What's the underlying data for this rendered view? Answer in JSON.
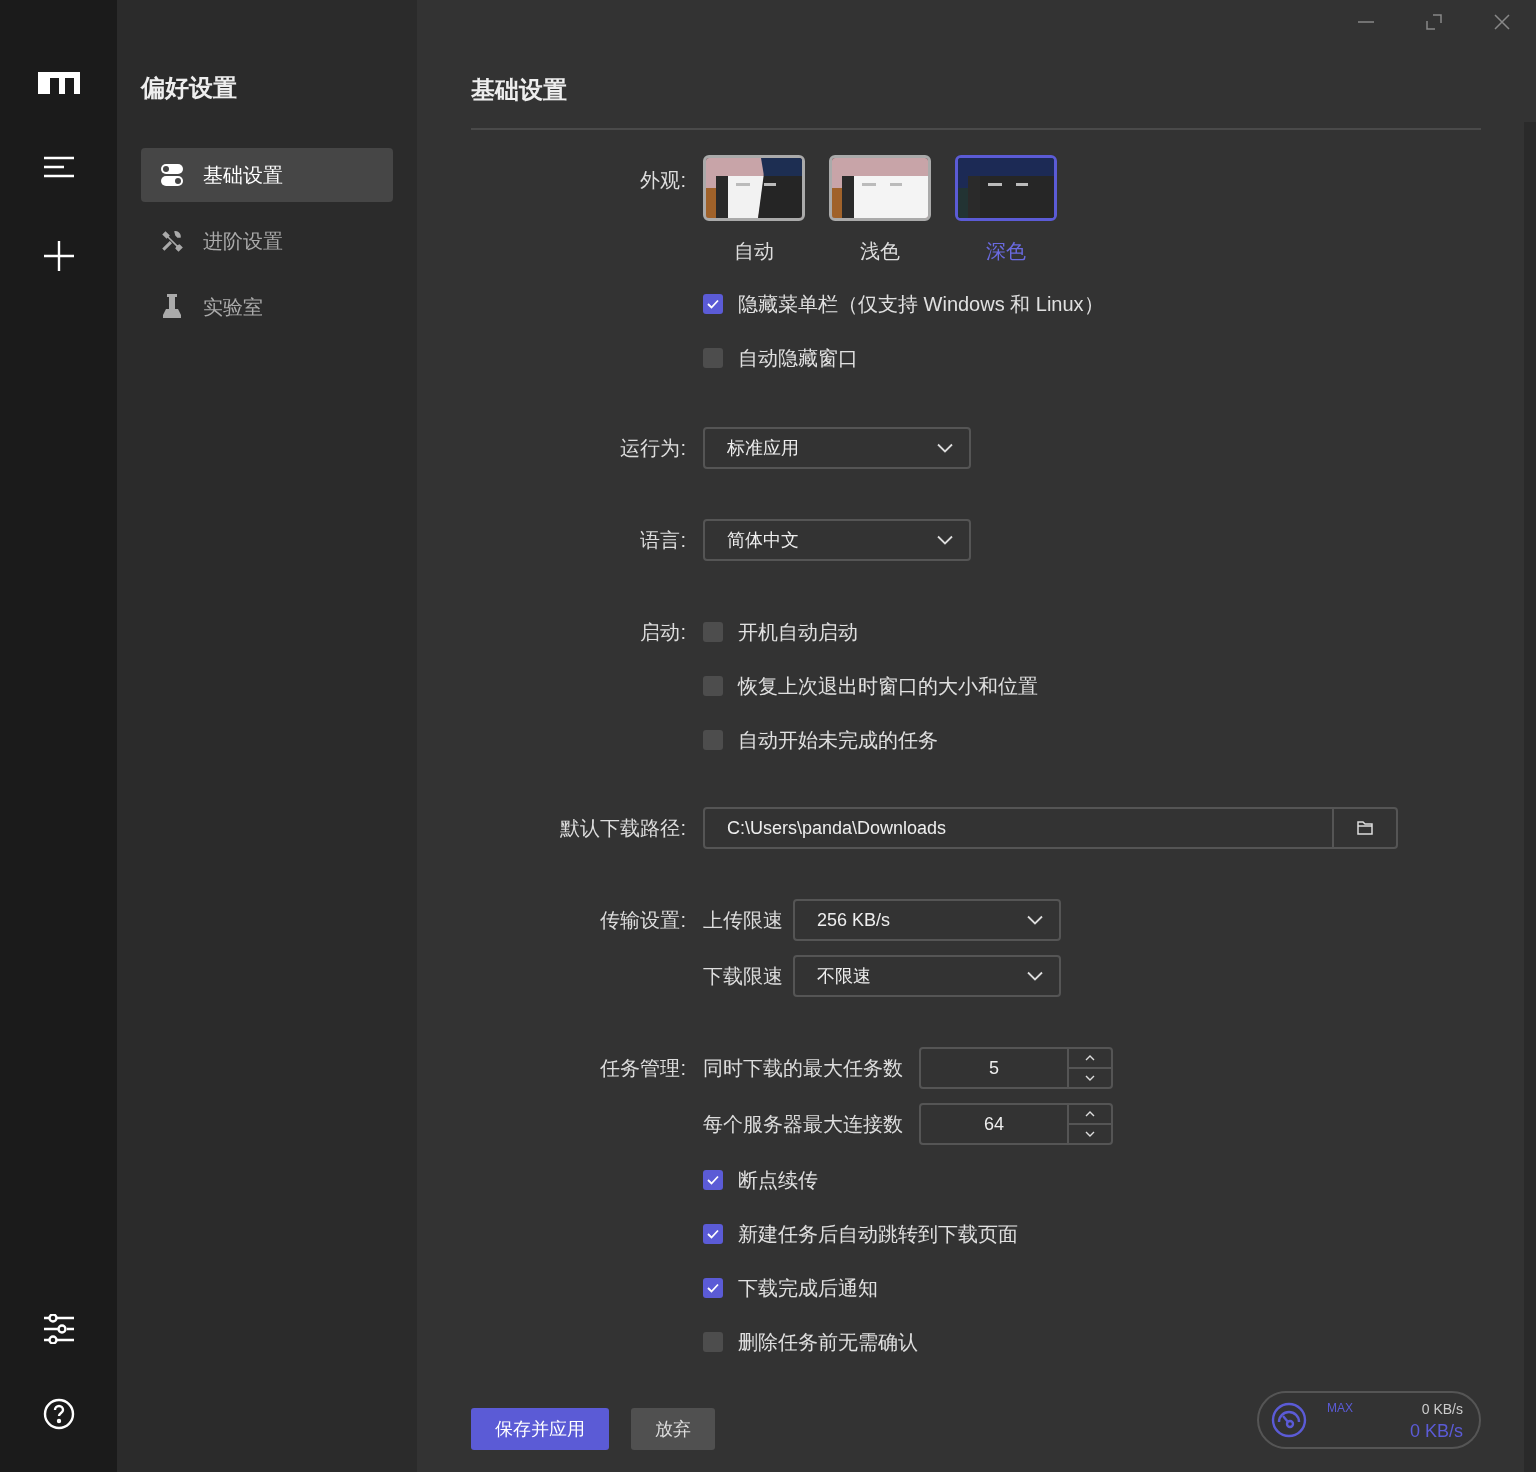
{
  "sidebar": {
    "title": "偏好设置",
    "items": [
      {
        "label": "基础设置",
        "selected": true
      },
      {
        "label": "进阶设置",
        "selected": false
      },
      {
        "label": "实验室",
        "selected": false
      }
    ]
  },
  "main": {
    "title": "基础设置",
    "sections": [
      {
        "kind": "appearance",
        "label": "外观:",
        "themes": [
          {
            "kind": "auto",
            "label": "自动",
            "selected": false
          },
          {
            "kind": "light",
            "label": "浅色",
            "selected": false
          },
          {
            "kind": "dark",
            "label": "深色",
            "selected": true
          }
        ],
        "options": [
          {
            "label": "隐藏菜单栏（仅支持 Windows 和 Linux）",
            "checked": true
          },
          {
            "label": "自动隐藏窗口",
            "checked": false
          }
        ]
      },
      {
        "kind": "select",
        "label": "运行为:",
        "value": "标准应用"
      },
      {
        "kind": "select",
        "label": "语言:",
        "value": "简体中文"
      },
      {
        "kind": "checks",
        "label": "启动:",
        "options": [
          {
            "label": "开机自动启动",
            "checked": false
          },
          {
            "label": "恢复上次退出时窗口的大小和位置",
            "checked": false
          },
          {
            "label": "自动开始未完成的任务",
            "checked": false
          }
        ]
      },
      {
        "kind": "path",
        "label": "默认下载路径:",
        "value": "C:\\Users\\panda\\Downloads"
      },
      {
        "kind": "transfer",
        "label": "传输设置:",
        "fields": [
          {
            "label": "上传限速",
            "value": "256 KB/s"
          },
          {
            "label": "下载限速",
            "value": "不限速"
          }
        ]
      },
      {
        "kind": "tasks",
        "label": "任务管理:",
        "numbers": [
          {
            "label": "同时下载的最大任务数",
            "value": "5"
          },
          {
            "label": "每个服务器最大连接数",
            "value": "64"
          }
        ],
        "options": [
          {
            "label": "断点续传",
            "checked": true
          },
          {
            "label": "新建任务后自动跳转到下载页面",
            "checked": true
          },
          {
            "label": "下载完成后通知",
            "checked": true
          },
          {
            "label": "删除任务前无需确认",
            "checked": false
          }
        ]
      }
    ],
    "buttons": [
      {
        "kind": "primary",
        "label": "保存并应用"
      },
      {
        "kind": "secondary",
        "label": "放弃"
      }
    ],
    "speed": {
      "max_label": "MAX",
      "upload": "0 KB/s",
      "download": "0 KB/s"
    }
  }
}
